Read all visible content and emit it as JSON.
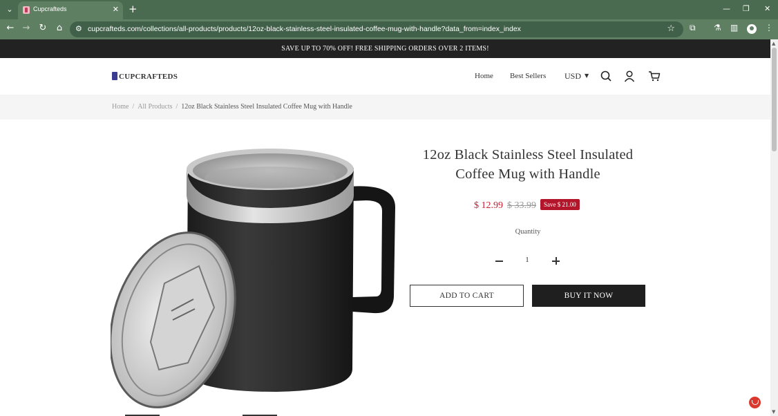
{
  "browser": {
    "tab_title": "Cupcrafteds",
    "url": "cupcrafteds.com/collections/all-products/products/12oz-black-stainless-steel-insulated-coffee-mug-with-handle?data_from=index_index",
    "accent": "#5f7f63"
  },
  "announcement": "SAVE UP TO 70% OFF! FREE SHIPPING ORDERS OVER 2 ITEMS!",
  "header": {
    "logo": "CUPCRAFTEDS",
    "nav": [
      "Home",
      "Best Sellers"
    ],
    "currency": "USD",
    "icons": [
      "search-icon",
      "account-icon",
      "cart-icon"
    ]
  },
  "breadcrumb": {
    "items": [
      "Home",
      "All Products"
    ],
    "current": "12oz Black Stainless Steel Insulated Coffee Mug with Handle"
  },
  "product": {
    "title": "12oz Black Stainless Steel Insulated Coffee Mug with Handle",
    "price": "$ 12.99",
    "compare_price": "$ 33.99",
    "save_badge": "Save $ 21.00",
    "quantity_label": "Quantity",
    "quantity": "1",
    "add_to_cart": "ADD TO CART",
    "buy_now": "BUY IT NOW",
    "price_color": "#c62032"
  }
}
